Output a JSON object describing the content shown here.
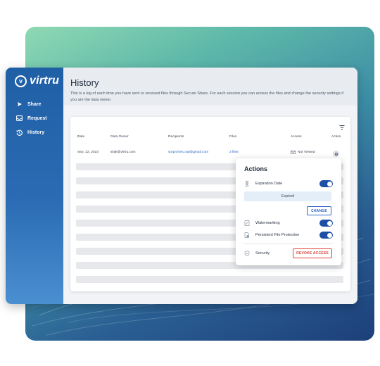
{
  "brand": {
    "logo_mark": "v",
    "name": "virtru"
  },
  "sidebar": {
    "items": [
      {
        "label": "Share",
        "icon": "send-icon"
      },
      {
        "label": "Request",
        "icon": "inbox-icon"
      },
      {
        "label": "History",
        "icon": "history-icon"
      }
    ]
  },
  "page": {
    "title": "History",
    "description": "This is a log of each time you have sent or received files through Secure Share. For each session you can access the files and change the security settings if you are the data owner."
  },
  "table": {
    "columns": [
      "Date",
      "Data Owner",
      "Recipients",
      "Files",
      "Access",
      "Action"
    ],
    "rows": [
      {
        "date": "Sep. 22, 2023",
        "owner": "sinjk@virtru.com",
        "recipients": "sorprcheru.sai@gmail.com",
        "files": "3 files",
        "access": "Not Viewed"
      }
    ]
  },
  "actions_panel": {
    "title": "Actions",
    "expiration_label": "Expiration Date",
    "expired_text": "Expired",
    "change_label": "CHANGE",
    "watermarking_label": "Watermarking",
    "pfp_label": "Persistent File Protection",
    "security_label": "Security",
    "revoke_label": "REVOKE ACCESS"
  },
  "colors": {
    "brand_blue": "#1f5fa6",
    "toggle_on": "#1d4fa6",
    "danger": "#d9433b",
    "link": "#2a64c4"
  }
}
